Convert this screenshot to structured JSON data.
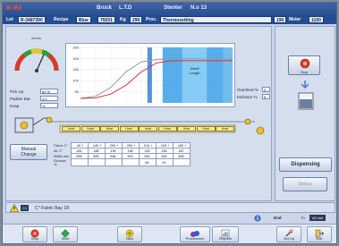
{
  "header": {
    "logo": "B-RI",
    "company": "Bruck",
    "company2": "L.T.D",
    "machine": "Stenter",
    "machine_no": "N.o 13"
  },
  "info_bar": {
    "lot_label": "Lot",
    "lot_value": "R-3487390",
    "recipe_label": "Recipe",
    "recipe_value": "Blue",
    "recipe_num": "79201",
    "kg_label": "Kg",
    "kg_value": "290",
    "proc_label": "Proc.",
    "proc_value": "Thermosetting",
    "value_190": "190",
    "meter_label": "Meter",
    "meter_value": "1100"
  },
  "gauge": {
    "label": "m/min"
  },
  "params": {
    "pickup_label": "Pick Up",
    "pickup_value": "60 %",
    "padder_label": "Padder Bar.",
    "padder_value": "4.0",
    "evap_label": "Evap.",
    "evap_value": "%",
    "overfeed_label": "Overfeed %",
    "overfeed_value": "3",
    "moisture_label": "Moisture %",
    "moisture_value": "5"
  },
  "chart": {
    "band_label_1": "Dwell",
    "band_label_2": "Length"
  },
  "chart_data": {
    "type": "line",
    "title": "",
    "xlabel": "",
    "ylabel": "",
    "y_ticks": [
      "250",
      "200",
      "150",
      "100",
      "50"
    ],
    "ylim": [
      0,
      250
    ],
    "grid": true,
    "legend": "none",
    "x": [
      0,
      1,
      2,
      3,
      4,
      5,
      6,
      7,
      8,
      9,
      10
    ],
    "series": [
      {
        "values": [
          20,
          30,
          70,
          140,
          185,
          195,
          198,
          198,
          198,
          198,
          198
        ],
        "color": "#999999"
      },
      {
        "values": [
          20,
          22,
          40,
          80,
          140,
          180,
          190,
          190,
          190,
          190,
          190
        ],
        "color": "#d03a3a"
      }
    ],
    "bands": [
      {
        "x0": 4.4,
        "x1": 4.7,
        "color": "#3a7fd8"
      },
      {
        "x0": 5.4,
        "x1": 6.7,
        "color": "#3aa0e8"
      },
      {
        "x0": 6.7,
        "x1": 8.3,
        "color": "#70c4f2"
      },
      {
        "x0": 8.3,
        "x1": 9.4,
        "color": "#3aa0e8"
      },
      {
        "x0": 9.4,
        "x1": 10,
        "color": "#5ab3ec"
      }
    ]
  },
  "machine": {
    "zones": [
      "Heat",
      "Heat",
      "Heat",
      "Heat",
      "Heat",
      "Heat",
      "Heat",
      "Heat",
      "Heat"
    ]
  },
  "manual_change_label_1": "Manual",
  "manual_change_label_2": "Change",
  "table": {
    "rows": [
      {
        "label": "Fabric  C°",
        "cells": [
          "- 40 +",
          "- 140 +",
          "- 200 +",
          "- 200 +",
          "- 210 +",
          "- 193 +",
          "- 182 +"
        ]
      },
      {
        "label": "Air     C°",
        "cells": [
          "181",
          "185",
          "190",
          "195",
          "190",
          "190",
          "187"
        ]
      },
      {
        "label": "Width  mm",
        "cells": [
          "896",
          "899",
          "896",
          "900",
          "900",
          "900",
          "899"
        ]
      },
      {
        "label": "Exhaust  %",
        "cells": [
          "",
          "",
          "",
          "",
          "80",
          "92",
          ""
        ]
      }
    ]
  },
  "side": {
    "stop_label": "Stop",
    "dispensing_label": "Dispensing",
    "status_label": "Status"
  },
  "status_bar": {
    "alarm_id": "C1",
    "message": "C° Fabric    Bay 1R",
    "end_label": "End",
    "in_label": "In",
    "in_value": "42 min"
  },
  "toolbar": {
    "stop": "Stop",
    "start": "Start",
    "new": "New",
    "procedures": "Procedures",
    "reports": "Reports",
    "setup": "Set Up",
    "exit": "Exit"
  }
}
